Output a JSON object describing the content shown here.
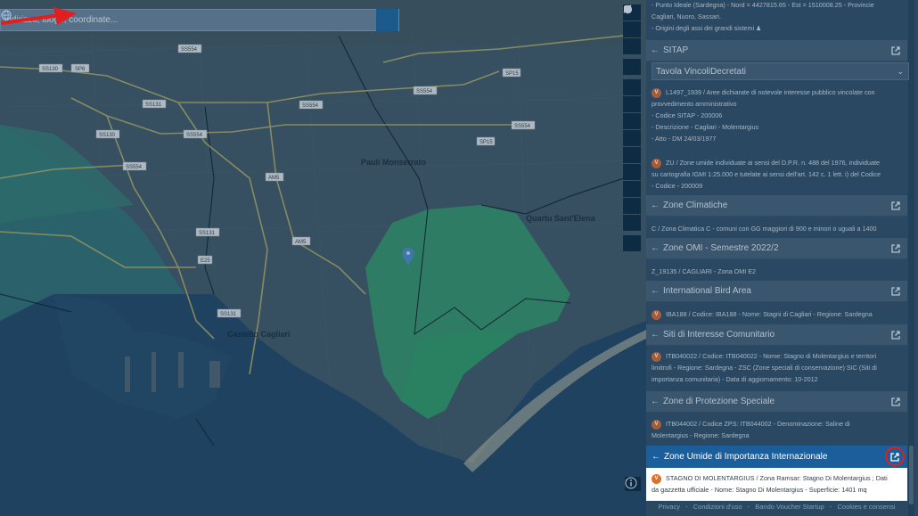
{
  "search": {
    "placeholder": "indirizzo, luogo, coordinate..."
  },
  "map": {
    "road_labels": [
      "SS130",
      "SP8",
      "SS554",
      "SS554",
      "SP15",
      "SS131",
      "SS130",
      "SS554",
      "SS554",
      "SS554",
      "SP15",
      "SS554",
      "AM5",
      "SS131",
      "AM5",
      "E25",
      "SS131"
    ],
    "area_labels": [
      "Pauli Monserrato",
      "Quartu Sant'Elena",
      "Castello Cagliari"
    ]
  },
  "panel": {
    "top_text": {
      "line1": "- Punto Ideale (Sardegna) - Nord = 4427815.65 - Est = 1510008.25 - Provincie",
      "line2": "Cagliari, Nuoro, Sassari.",
      "line3": "- Origini degli assi dei grandi sistemi ♟"
    },
    "sitap": {
      "title": "SITAP",
      "select_value": "Tavola VincoliDecretati",
      "item1_badge": "V",
      "item1_line1": "L1497_1939 / Aree dichiarate di notevole interesse pubblico vincolate con",
      "item1_line2": "provvedimento amministrativo",
      "item1_line3": "- Codice SITAP - 200006",
      "item1_line4": "- Descrizione - Cagliari - Molentargius",
      "item1_line5": "- Atto - DM 24/03/1977",
      "item2_badge": "V",
      "item2_line1": "ZU / Zone umide individuate ai sensi del D.P.R. n. 488 del 1976, individuate",
      "item2_line2": "su cartografia IGMI 1:25.000 e tutelate ai sensi dell'art. 142 c. 1 lett. i) del Codice",
      "item2_line3": "- Codice - 200009"
    },
    "zone_climatiche": {
      "title": "Zone Climatiche",
      "text": "C / Zona Climatica C - comuni con GG maggiori di 900 e minori o uguali a 1400"
    },
    "zone_omi": {
      "title": "Zone OMI - Semestre 2022/2",
      "text": "Z_19135 / CAGLIARI - Zona OMI E2"
    },
    "bird_area": {
      "title": "International Bird Area",
      "badge": "V",
      "text": "IBA188 / Codice: IBA188 - Nome: Stagni di Cagliari - Regione: Sardegna"
    },
    "sic": {
      "title": "Siti di Interesse Comunitario",
      "badge": "V",
      "line1": "ITB040022 / Codice: ITB040022 - Nome: Stagno di Molentargius e territori",
      "line2": "limitrofi - Regione: Sardegna - ZSC (Zone speciali di conservazione) SIC (Siti di",
      "line3": "importanza comunitaria) - Data di aggiornamento: 10-2012"
    },
    "zps": {
      "title": "Zone di Protezione Speciale",
      "badge": "V",
      "line1": "ITB044002 / Codice ZPS: ITB044002 - Denominazione: Saline di",
      "line2": "Molentargius - Regione: Sardegna"
    },
    "ramsar": {
      "title": "Zone Umide di Importanza Internazionale",
      "badge": "V",
      "line1": "STAGNO DI MOLENTARGIUS / Zona Ramsar: Stagno Di Molentargius ; Dati",
      "line2": "da gazzetta ufficiale - Nome: Stagno Di Molentargius - Superficie: 1401 mq"
    },
    "footer": {
      "privacy": "Privacy",
      "sep1": "-",
      "conditions": "Condizioni d'uso",
      "sep2": "-",
      "bando": "Bando Voucher Startup",
      "sep3": "-",
      "cookies": "Cookies e consensi"
    }
  },
  "colors": {
    "accent": "#1a5f9c",
    "badge": "#a45d3a",
    "highlight_arrow": "#e21e1e",
    "wetland": "#2fa36b"
  },
  "icons": {
    "search": "globe-icon",
    "zoom_in": "plus-icon",
    "zoom_out": "minus-icon",
    "north": "compass-icon",
    "locate": "crosshair-icon",
    "measure": "ruler-icon",
    "area": "polygon-icon",
    "marker": "pin-icon",
    "circle": "circle-icon",
    "delete": "trash-icon",
    "layers": "layers-icon",
    "place": "place-icon",
    "download": "download-icon",
    "bookmark": "bookmark-icon",
    "basemap": "map-style-icon",
    "collapse": "arrow-right-icon",
    "info": "info-icon",
    "external": "external-link-icon"
  }
}
